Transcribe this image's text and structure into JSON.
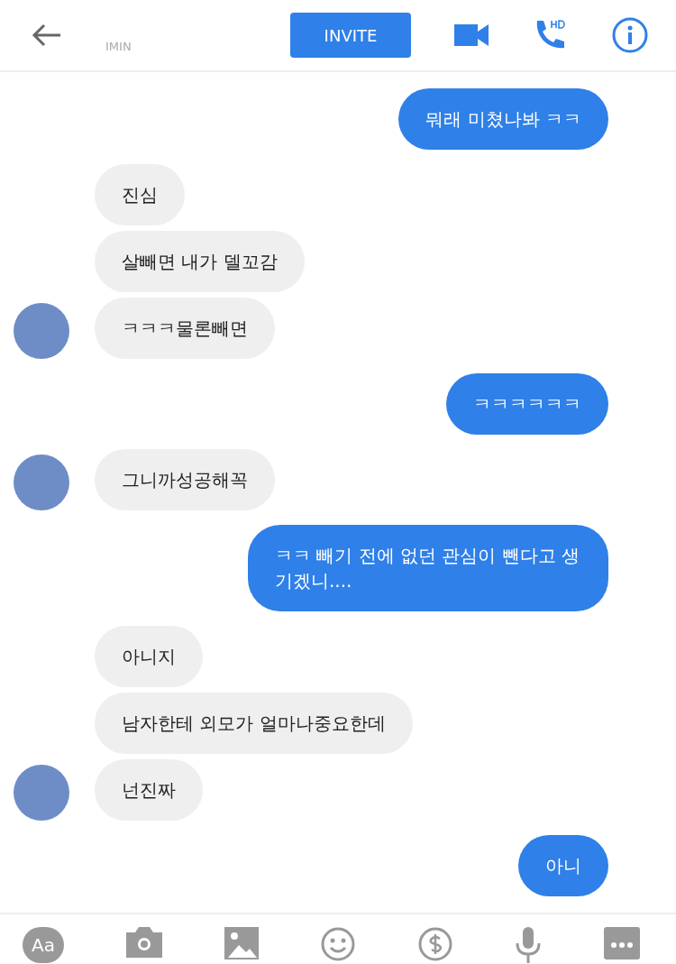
{
  "header": {
    "subtitle": "IMIN",
    "invite_label": "INVITE"
  },
  "messages": [
    {
      "kind": "outgoing",
      "text": "뭐래 미쳤나봐 ㅋㅋ",
      "avatar": false
    },
    {
      "kind": "incoming",
      "text": "진심",
      "avatar": false
    },
    {
      "kind": "incoming",
      "text": "살빼면 내가 델꼬감",
      "avatar": false
    },
    {
      "kind": "incoming",
      "text": "ㅋㅋㅋ물론빼면",
      "avatar": true
    },
    {
      "kind": "outgoing",
      "text": "ㅋㅋㅋㅋㅋㅋ",
      "avatar": false
    },
    {
      "kind": "incoming",
      "text": "그니까성공해꼭",
      "avatar": true
    },
    {
      "kind": "outgoing",
      "text": "ㅋㅋ 빼기 전에 없던 관심이 뺀다고 생기겠니....",
      "avatar": false
    },
    {
      "kind": "incoming",
      "text": "아니지",
      "avatar": false
    },
    {
      "kind": "incoming",
      "text": "남자한테 외모가 얼마나중요한데",
      "avatar": false
    },
    {
      "kind": "incoming",
      "text": "넌진짜",
      "avatar": true
    },
    {
      "kind": "outgoing",
      "text": "아니",
      "avatar": false
    }
  ],
  "toolbar": {
    "text_button": "Aa"
  }
}
